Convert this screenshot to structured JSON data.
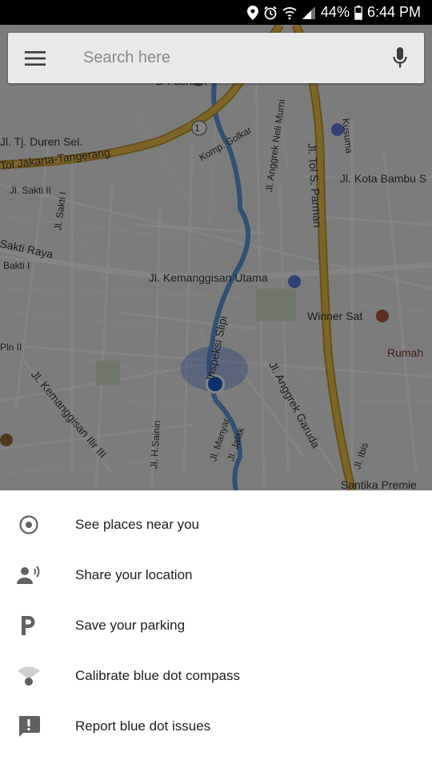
{
  "status_bar": {
    "battery": "44%",
    "time": "6:44 PM"
  },
  "search": {
    "placeholder": "Search here"
  },
  "map_labels": {
    "fashion": "D Fashion",
    "duren": "Jl. Tj. Duren Sel.",
    "tol_jkt": "Tol Jakarta-Tangerang",
    "sakti2": "Jl. Sakti II",
    "sakti1": "Jl. Sakti I",
    "sakti_raya": "Sakti Raya",
    "bakti": "Bakti I",
    "golkar": "Komp. Golkar",
    "anggrek_neli": "Jl. Anggrek Neli Murni",
    "tol_parman": "Jl. Tol S. Parman",
    "kota_bambu": "Jl. Kota Bambu S",
    "kemanggisan_utama": "Jl. Kemanggisan Utama",
    "winner": "Winner Sat",
    "rumah": "Rumah",
    "pln": "Pln II",
    "inspeksi": "Inspeksi Slipi",
    "kemanggisan3": "Jl. Kemanggisan Ilir III",
    "anggrek_garuda": "Jl. Anggrek Garuda",
    "hsainin": "Jl. H.Sainin",
    "manyar": "Jl. Manyar",
    "jalak": "Jl. Jalak",
    "ibis": "Jl. Ibis",
    "santika": "Santika Premie",
    "kusuma": "Kusuma",
    "route1": "1"
  },
  "menu": {
    "items": [
      {
        "label": "See places near you",
        "icon": "target-icon"
      },
      {
        "label": "Share your location",
        "icon": "share-location-icon"
      },
      {
        "label": "Save your parking",
        "icon": "parking-icon"
      },
      {
        "label": "Calibrate blue dot compass",
        "icon": "compass-calibrate-icon"
      },
      {
        "label": "Report blue dot issues",
        "icon": "report-icon"
      }
    ]
  },
  "colors": {
    "blue_dot": "#1a5bd6",
    "highway": "#e8b23a",
    "river": "#5a9be0"
  }
}
